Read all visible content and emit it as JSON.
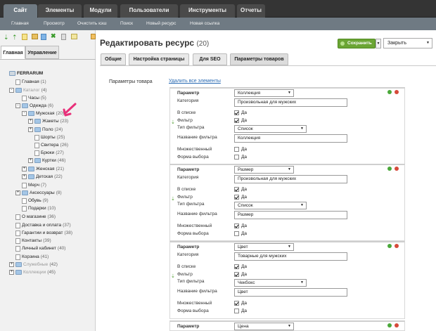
{
  "top_tabs": [
    {
      "label": "Сайт"
    },
    {
      "label": "Элементы"
    },
    {
      "label": "Модули"
    },
    {
      "label": "Пользователи"
    },
    {
      "label": "Инструменты"
    },
    {
      "label": "Отчеты"
    }
  ],
  "sub_links": [
    "Главная",
    "Просмотр",
    "Очистить кэш",
    "Поиск",
    "Новый ресурс",
    "Новая ссылка"
  ],
  "side_tabs": [
    "Главная",
    "Управление"
  ],
  "tree": [
    {
      "label": "FERRARUM",
      "count": "",
      "level": 0,
      "toggle": "",
      "icon": "none",
      "dim": false,
      "bold": true
    },
    {
      "label": "Главная",
      "count": "(1)",
      "level": 1,
      "toggle": "",
      "icon": "page",
      "dim": false
    },
    {
      "label": "Каталог",
      "count": "(4)",
      "level": 1,
      "toggle": "-",
      "icon": "folder",
      "dim": true
    },
    {
      "label": "Часы",
      "count": "(5)",
      "level": 2,
      "toggle": "",
      "icon": "page",
      "dim": false
    },
    {
      "label": "Одежда",
      "count": "(6)",
      "level": 2,
      "toggle": "-",
      "icon": "folder",
      "dim": false
    },
    {
      "label": "Мужская",
      "count": "(20)",
      "level": 3,
      "toggle": "-",
      "icon": "folder",
      "dim": false
    },
    {
      "label": "Жакеты",
      "count": "(23)",
      "level": 4,
      "toggle": "+",
      "icon": "folder",
      "dim": false
    },
    {
      "label": "Поло",
      "count": "(24)",
      "level": 4,
      "toggle": "+",
      "icon": "folder",
      "dim": false
    },
    {
      "label": "Шорты",
      "count": "(25)",
      "level": 4,
      "toggle": "",
      "icon": "page",
      "dim": false
    },
    {
      "label": "Свитера",
      "count": "(26)",
      "level": 4,
      "toggle": "",
      "icon": "page",
      "dim": false
    },
    {
      "label": "Брюки",
      "count": "(27)",
      "level": 4,
      "toggle": "",
      "icon": "page",
      "dim": false
    },
    {
      "label": "Куртки",
      "count": "(46)",
      "level": 4,
      "toggle": "+",
      "icon": "folder",
      "dim": false
    },
    {
      "label": "Женская",
      "count": "(21)",
      "level": 3,
      "toggle": "+",
      "icon": "folder",
      "dim": false
    },
    {
      "label": "Детская",
      "count": "(22)",
      "level": 3,
      "toggle": "+",
      "icon": "folder",
      "dim": false
    },
    {
      "label": "Мерч",
      "count": "(7)",
      "level": 2,
      "toggle": "",
      "icon": "page",
      "dim": false
    },
    {
      "label": "Аксессуары",
      "count": "(8)",
      "level": 2,
      "toggle": "+",
      "icon": "folder",
      "dim": false
    },
    {
      "label": "Обувь",
      "count": "(9)",
      "level": 2,
      "toggle": "",
      "icon": "page",
      "dim": false
    },
    {
      "label": "Подарки",
      "count": "(10)",
      "level": 2,
      "toggle": "",
      "icon": "page",
      "dim": false
    },
    {
      "label": "О магазине",
      "count": "(36)",
      "level": 1,
      "toggle": "",
      "icon": "page",
      "dim": false
    },
    {
      "label": "Доставка и оплата",
      "count": "(37)",
      "level": 1,
      "toggle": "",
      "icon": "page",
      "dim": false
    },
    {
      "label": "Гарантии и возврат",
      "count": "(38)",
      "level": 1,
      "toggle": "",
      "icon": "page",
      "dim": false
    },
    {
      "label": "Контакты",
      "count": "(39)",
      "level": 1,
      "toggle": "",
      "icon": "page",
      "dim": false
    },
    {
      "label": "Личный кабинет",
      "count": "(40)",
      "level": 1,
      "toggle": "",
      "icon": "page",
      "dim": false
    },
    {
      "label": "Корзина",
      "count": "(41)",
      "level": 1,
      "toggle": "",
      "icon": "page",
      "dim": false
    },
    {
      "label": "Служебные",
      "count": "(42)",
      "level": 1,
      "toggle": "+",
      "icon": "folder",
      "dim": true
    },
    {
      "label": "Коллекции",
      "count": "(45)",
      "level": 1,
      "toggle": "+",
      "icon": "folder",
      "dim": true
    }
  ],
  "page": {
    "title": "Редактировать ресурс",
    "id": "(20)",
    "save": "Сохранить",
    "close": "Закрыть"
  },
  "content_tabs": [
    "Общие",
    "Настройка страницы",
    "Для SEO",
    "Параметры товаров"
  ],
  "params_label": "Параметры товара",
  "delete_all": "Удалить все элементы",
  "labels": {
    "param": "Параметр",
    "category": "Категория",
    "in_list": "В списке",
    "filter": "Фильтр",
    "filter_type": "Тип фильтра",
    "filter_name": "Название фильтра",
    "multiple": "Множественный",
    "choice_form": "Форма выбора",
    "yes": "Да"
  },
  "param_cards": [
    {
      "param": "Коллекция",
      "category": "Произвольная для мужских",
      "in_list": true,
      "filter": true,
      "filter_type": "Список",
      "filter_name": "Коллекция",
      "multiple": false,
      "choice_form": false
    },
    {
      "param": "Размер",
      "category": "Произвольная для мужских",
      "in_list": true,
      "filter": true,
      "filter_type": "Список",
      "filter_name": "Размер",
      "multiple": true,
      "choice_form": false
    },
    {
      "param": "Цвет",
      "category": "Товарные для мужских",
      "in_list": true,
      "filter": true,
      "filter_type": "Чекбокс",
      "filter_name": "Цвет",
      "multiple": true,
      "choice_form": false
    },
    {
      "param": "Цена"
    }
  ],
  "colors": {
    "topbar": "#343434",
    "active_tab": "#6f7a83",
    "save_green": "#6ba534",
    "annotation": "#e8307a"
  }
}
